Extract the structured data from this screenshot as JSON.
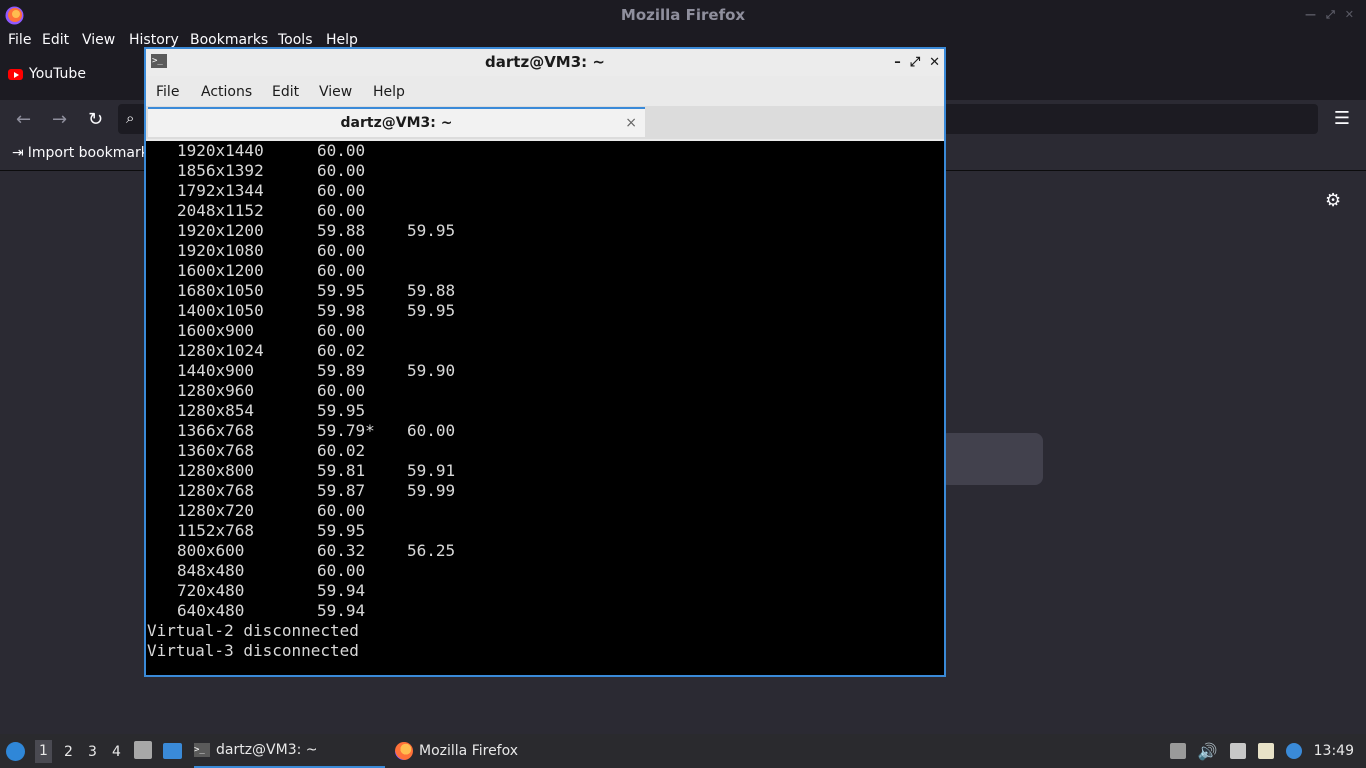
{
  "firefox": {
    "window_title": "Mozilla Firefox",
    "menu": [
      "File",
      "Edit",
      "View",
      "History",
      "Bookmarks",
      "Tools",
      "Help"
    ],
    "tab_label": "YouTube",
    "import_bookmarks_label": "Import bookmark",
    "icons": {
      "back": "arrow-left-icon",
      "forward": "arrow-right-icon",
      "reload": "reload-icon",
      "search": "search-icon",
      "menu": "hamburger-icon",
      "settings": "gear-icon"
    }
  },
  "terminal": {
    "window_title": "dartz@VM3: ~",
    "menu": [
      "File",
      "Actions",
      "Edit",
      "View",
      "Help"
    ],
    "tab_title": "dartz@VM3: ~",
    "tab_close": "×",
    "modes": [
      {
        "res": "1920x1440",
        "r1": "60.00",
        "r2": ""
      },
      {
        "res": "1856x1392",
        "r1": "60.00",
        "r2": ""
      },
      {
        "res": "1792x1344",
        "r1": "60.00",
        "r2": ""
      },
      {
        "res": "2048x1152",
        "r1": "60.00",
        "r2": ""
      },
      {
        "res": "1920x1200",
        "r1": "59.88",
        "r2": "59.95"
      },
      {
        "res": "1920x1080",
        "r1": "60.00",
        "r2": ""
      },
      {
        "res": "1600x1200",
        "r1": "60.00",
        "r2": ""
      },
      {
        "res": "1680x1050",
        "r1": "59.95",
        "r2": "59.88"
      },
      {
        "res": "1400x1050",
        "r1": "59.98",
        "r2": "59.95"
      },
      {
        "res": "1600x900",
        "r1": "60.00",
        "r2": ""
      },
      {
        "res": "1280x1024",
        "r1": "60.02",
        "r2": ""
      },
      {
        "res": "1440x900",
        "r1": "59.89",
        "r2": "59.90"
      },
      {
        "res": "1280x960",
        "r1": "60.00",
        "r2": ""
      },
      {
        "res": "1280x854",
        "r1": "59.95",
        "r2": ""
      },
      {
        "res": "1366x768",
        "r1": "59.79*",
        "r2": "60.00"
      },
      {
        "res": "1360x768",
        "r1": "60.02",
        "r2": ""
      },
      {
        "res": "1280x800",
        "r1": "59.81",
        "r2": "59.91"
      },
      {
        "res": "1280x768",
        "r1": "59.87",
        "r2": "59.99"
      },
      {
        "res": "1280x720",
        "r1": "60.00",
        "r2": ""
      },
      {
        "res": "1152x768",
        "r1": "59.95",
        "r2": ""
      },
      {
        "res": "800x600",
        "r1": "60.32",
        "r2": "56.25"
      },
      {
        "res": "848x480",
        "r1": "60.00",
        "r2": ""
      },
      {
        "res": "720x480",
        "r1": "59.94",
        "r2": ""
      },
      {
        "res": "640x480",
        "r1": "59.94",
        "r2": ""
      }
    ],
    "messages": [
      "Virtual-2 disconnected",
      "Virtual-3 disconnected"
    ]
  },
  "taskbar": {
    "workspaces": [
      "1",
      "2",
      "3",
      "4"
    ],
    "tasks": [
      {
        "label": "dartz@VM3: ~",
        "icon": "terminal-icon"
      },
      {
        "label": "Mozilla Firefox",
        "icon": "firefox-icon"
      }
    ],
    "clock": "13:49",
    "tray_icons": [
      "sd-card-icon",
      "volume-icon",
      "network-icon",
      "clipboard-icon",
      "notification-icon"
    ]
  }
}
